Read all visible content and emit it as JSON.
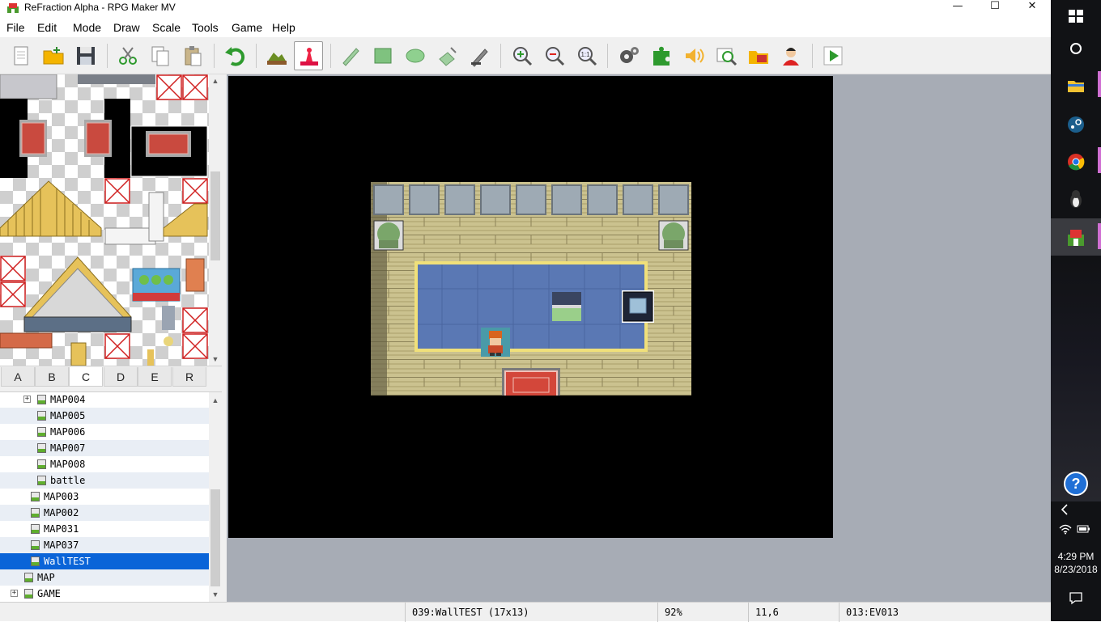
{
  "window": {
    "title": "ReFraction Alpha - RPG Maker MV",
    "minimize": "—",
    "maximize": "☐",
    "close": "✕"
  },
  "menu": [
    "File",
    "Edit",
    "Mode",
    "Draw",
    "Scale",
    "Tools",
    "Game",
    "Help"
  ],
  "toolbar": {
    "icons": [
      "new-icon",
      "open-icon",
      "save-icon",
      "cut-icon",
      "copy-icon",
      "paste-icon",
      "undo-icon",
      "map-mode-icon",
      "event-mode-icon",
      "pencil-icon",
      "rectangle-icon",
      "ellipse-icon",
      "fill-icon",
      "shadow-pen-icon",
      "zoom-in-icon",
      "zoom-out-icon",
      "zoom-actual-icon",
      "database-icon",
      "plugin-manager-icon",
      "sound-test-icon",
      "event-searcher-icon",
      "resource-manager-icon",
      "character-generator-icon",
      "playtest-icon"
    ],
    "active": "event-mode-icon",
    "zoom_actual_label": "1:1"
  },
  "tileset_tabs": [
    "A",
    "B",
    "C",
    "D",
    "E",
    "R"
  ],
  "tileset_selected_tab": "C",
  "map_tree": [
    {
      "label": "MAP004",
      "indent": 2,
      "expander": "+"
    },
    {
      "label": "MAP005",
      "indent": 2
    },
    {
      "label": "MAP006",
      "indent": 2
    },
    {
      "label": "MAP007",
      "indent": 2
    },
    {
      "label": "MAP008",
      "indent": 2
    },
    {
      "label": "battle",
      "indent": 2
    },
    {
      "label": "MAP003",
      "indent": 1
    },
    {
      "label": "MAP002",
      "indent": 1
    },
    {
      "label": "MAP031",
      "indent": 1
    },
    {
      "label": "MAP037",
      "indent": 1
    },
    {
      "label": "WallTEST",
      "indent": 1,
      "selected": true
    },
    {
      "label": "MAP",
      "indent": 0
    },
    {
      "label": "GAME",
      "indent": 0,
      "expander": "+"
    }
  ],
  "status": {
    "map": "039:WallTEST (17x13)",
    "zoom": "92%",
    "coords": "11,6",
    "event": "013:EV013"
  },
  "taskbar": {
    "icons": [
      "windows-start-icon",
      "cortana-icon",
      "file-explorer-icon",
      "steam-icon",
      "chrome-icon",
      "penguin-app-icon",
      "rpg-maker-icon",
      "help-icon",
      "chevron-left-icon",
      "wifi-icon",
      "battery-icon",
      "notifications-icon"
    ],
    "time": "4:29 PM",
    "date": "8/23/2018"
  },
  "colors": {
    "selection": "#0a64d8",
    "canvas_bg": "#000000",
    "workspace_bg": "#a7acb5",
    "carpet": "#5a78b4",
    "floor": "#c8c08a"
  }
}
